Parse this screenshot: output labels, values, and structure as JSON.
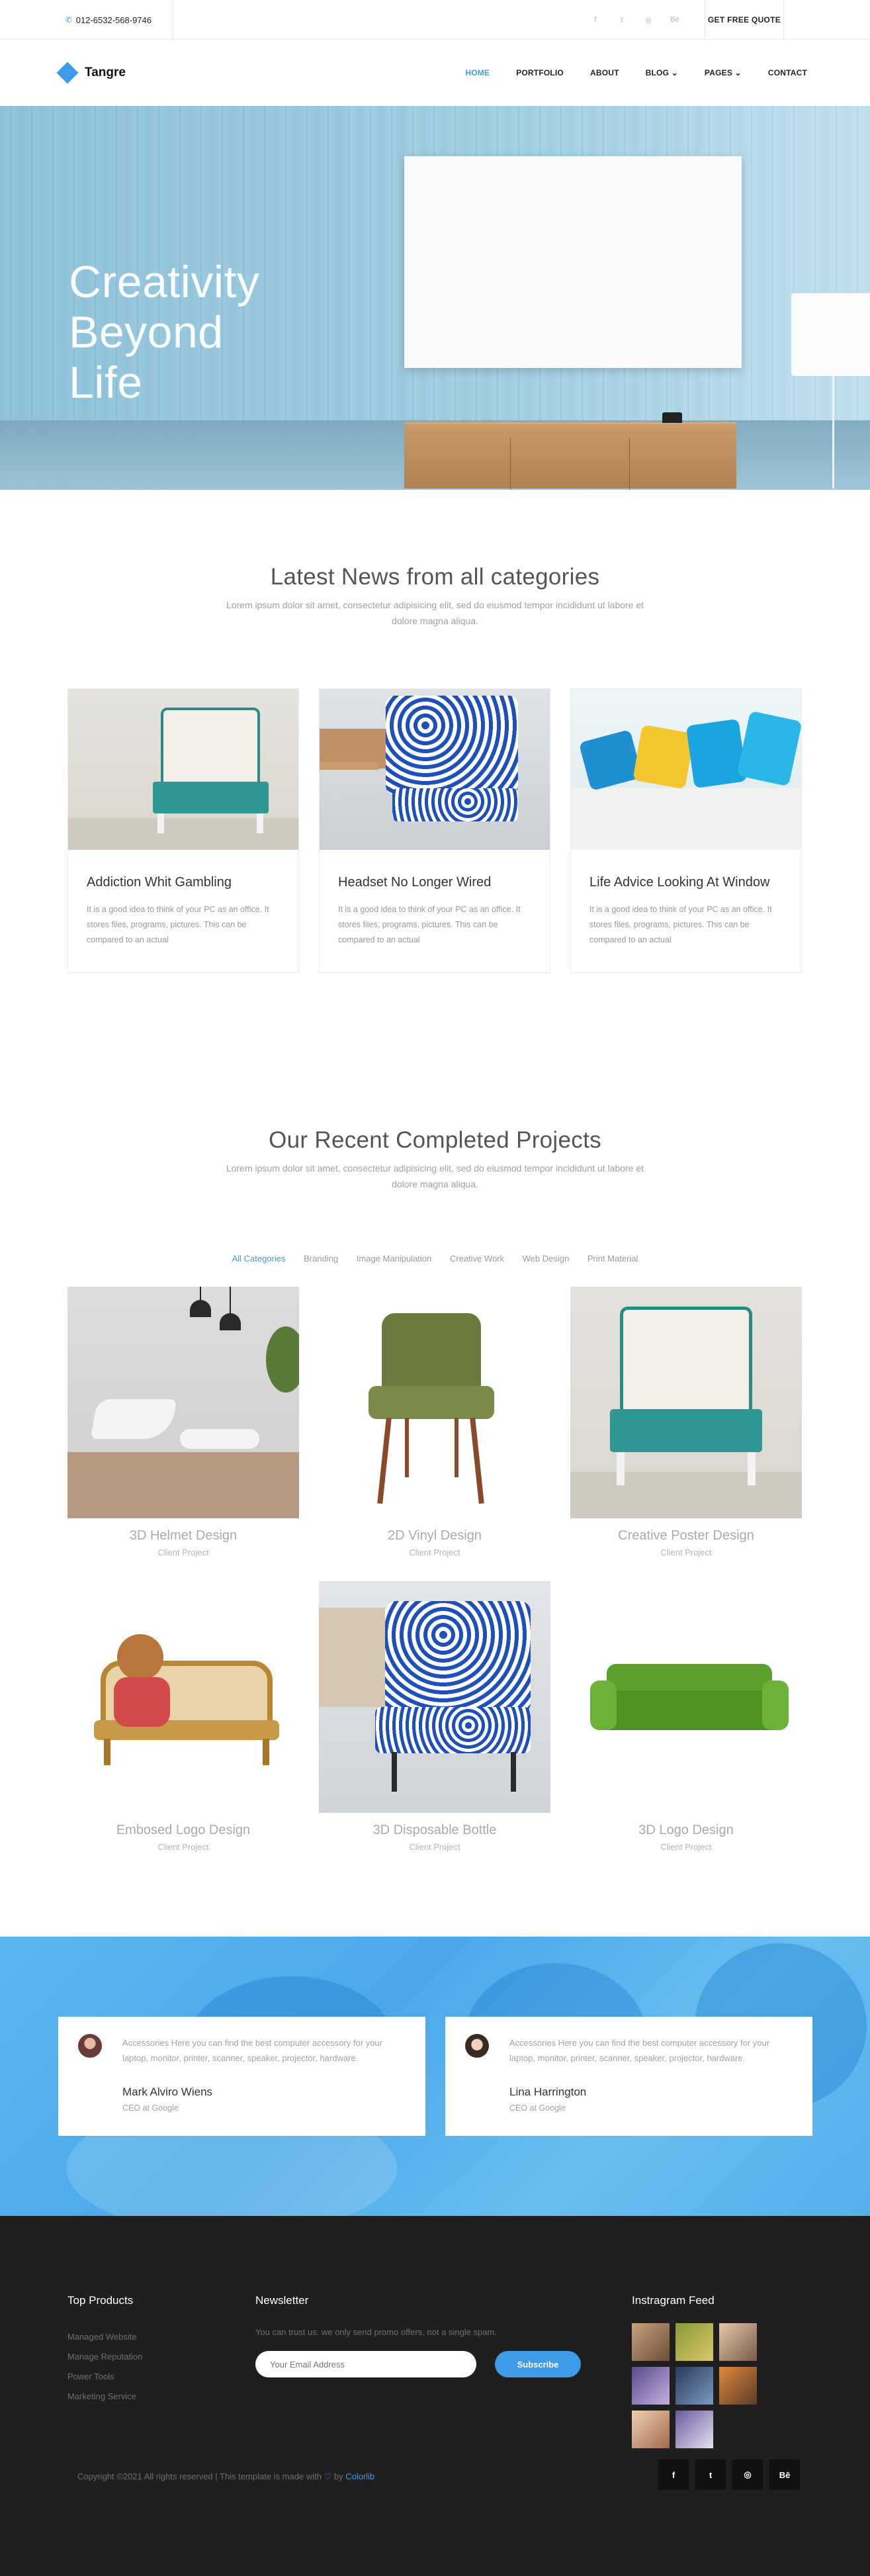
{
  "topbar": {
    "phone": "012-6532-568-9746",
    "socials": [
      "f",
      "t",
      "◎",
      "Bē"
    ],
    "quote_label": "GET FREE QUOTE"
  },
  "nav": {
    "brand": "Tangre",
    "items": [
      {
        "label": "HOME",
        "active": true
      },
      {
        "label": "PORTFOLIO"
      },
      {
        "label": "ABOUT"
      },
      {
        "label": "BLOG ⌄"
      },
      {
        "label": "PAGES ⌄"
      },
      {
        "label": "CONTACT"
      }
    ]
  },
  "hero": {
    "line1": "Creativity",
    "line2": "Beyond",
    "line3": "Life"
  },
  "news": {
    "title": "Latest News from all categories",
    "subtitle": "Lorem ipsum dolor sit amet, consectetur adipisicing elit, sed do eiusmod tempor incididunt ut labore et dolore magna aliqua.",
    "cards": [
      {
        "title": "Addiction Whit Gambling",
        "text": "It is a good idea to think of your PC as an office. It stores files, programs, pictures. This can be compared to an actual"
      },
      {
        "title": "Headset No Longer Wired",
        "text": "It is a good idea to think of your PC as an office. It stores files, programs, pictures. This can be compared to an actual"
      },
      {
        "title": "Life Advice Looking At Window",
        "text": "It is a good idea to think of your PC as an office. It stores files, programs, pictures. This can be compared to an actual"
      }
    ]
  },
  "projects": {
    "title": "Our Recent Completed Projects",
    "subtitle": "Lorem ipsum dolor sit amet, consectetur adipisicing elit, sed do eiusmod tempor incididunt ut labore et dolore magna aliqua.",
    "filters": [
      "All Categories",
      "Branding",
      "Image Manipulation",
      "Creative Work",
      "Web Design",
      "Print Material"
    ],
    "items": [
      {
        "title": "3D Helmet Design",
        "sub": "Client Project"
      },
      {
        "title": "2D Vinyl Design",
        "sub": "Client Project"
      },
      {
        "title": "Creative Poster Design",
        "sub": "Client Project"
      },
      {
        "title": "Embosed Logo Design",
        "sub": "Client Project"
      },
      {
        "title": "3D Disposable Bottle",
        "sub": "Client Project"
      },
      {
        "title": "3D Logo Design",
        "sub": "Client Project"
      }
    ]
  },
  "testimonials": [
    {
      "quote": "Accessories Here you can find the best computer accessory for your laptop, monitor, printer, scanner, speaker, projector, hardware.",
      "name": "Mark Alviro Wiens",
      "role": "CEO at Google"
    },
    {
      "quote": "Accessories Here you can find the best computer accessory for your laptop, monitor, printer, scanner, speaker, projector, hardware.",
      "name": "Lina Harrington",
      "role": "CEO at Google"
    }
  ],
  "footer": {
    "products_title": "Top Products",
    "products": [
      "Managed Website",
      "Manage Reputation",
      "Power Tools",
      "Marketing Service"
    ],
    "newsletter_title": "Newsletter",
    "newsletter_text": "You can trust us. we only send promo offers, not a single spam.",
    "email_placeholder": "Your Email Address",
    "subscribe_label": "Subscribe",
    "instagram_title": "Instragram Feed",
    "copyright_pre": "Copyright ©2021 All rights reserved | This template is made with",
    "copyright_by": "by",
    "copyright_brand": "Colorlib",
    "socials": [
      "f",
      "t",
      "◎",
      "Bē"
    ]
  },
  "colors": {
    "accent": "#3d9be9",
    "footer_bg": "#1f1f1f"
  }
}
